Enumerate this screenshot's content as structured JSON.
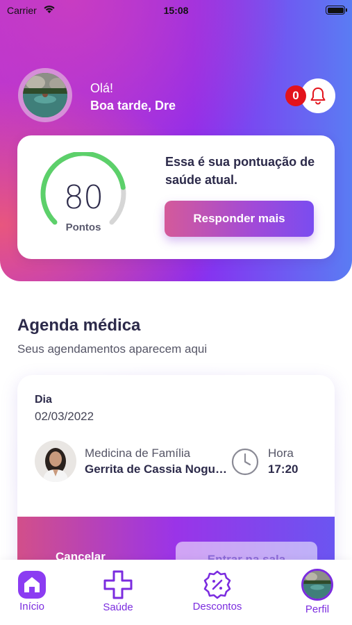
{
  "status_bar": {
    "carrier": "Carrier",
    "time": "15:08"
  },
  "header": {
    "greeting": "Olá!",
    "name_line": "Boa tarde, Dre",
    "notification_count": "0"
  },
  "score_card": {
    "score": "80",
    "score_fraction": 0.8,
    "score_unit": "Pontos",
    "description": "Essa é sua pontuação de saúde atual.",
    "button_label": "Responder mais"
  },
  "agenda": {
    "title": "Agenda médica",
    "subtitle": "Seus agendamentos aparecem aqui",
    "appointment": {
      "day_label": "Dia",
      "date": "02/03/2022",
      "specialty": "Medicina de Família",
      "doctor": "Gerrita de Cassia Nogueira",
      "hour_label": "Hora",
      "hour": "17:20",
      "cancel_label": "Cancelar",
      "enter_label": "Entrar na sala"
    }
  },
  "tab_bar": {
    "items": [
      {
        "label": "Início"
      },
      {
        "label": "Saúde"
      },
      {
        "label": "Descontos"
      },
      {
        "label": "Perfil"
      }
    ]
  },
  "colors": {
    "accent": "#7b2cdf",
    "gauge_green": "#5cd06a",
    "gauge_gray": "#d6d6d6",
    "badge_red": "#e3131b"
  }
}
